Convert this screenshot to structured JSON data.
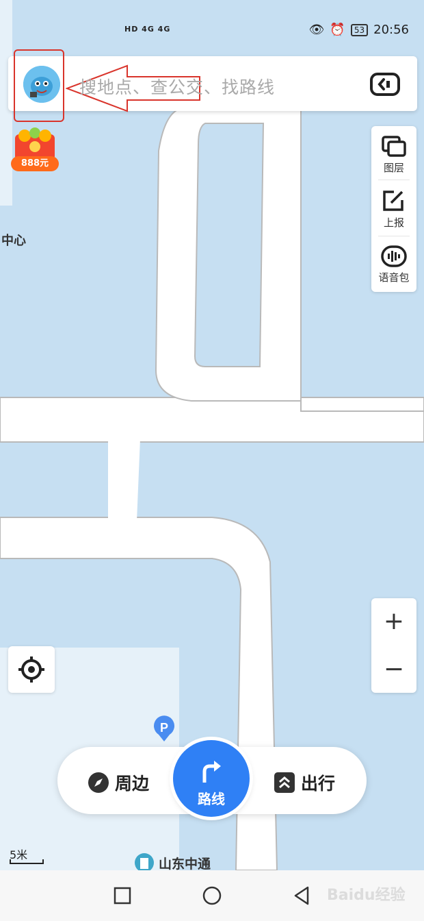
{
  "status_bar": {
    "network_left": "HD 4G 4G",
    "time": "20:56",
    "battery": "53"
  },
  "search": {
    "placeholder": "搜地点、查公交、找路线"
  },
  "promo": {
    "amount": "888元"
  },
  "map_labels": {
    "place_left": "中心",
    "poi_bottom": "山东中通"
  },
  "toolbar": {
    "layers": "图层",
    "report": "上报",
    "voice_pack": "语音包"
  },
  "zoom": {
    "in": "+",
    "out": "−"
  },
  "bottom_nav": {
    "nearby": "周边",
    "route": "路线",
    "travel": "出行"
  },
  "scale": {
    "label": "5米"
  },
  "watermark": "Baidu经验",
  "colors": {
    "map_bg": "#c6dff2",
    "road": "#ffffff",
    "accent": "#2f80f5",
    "highlight": "#d9342b"
  }
}
